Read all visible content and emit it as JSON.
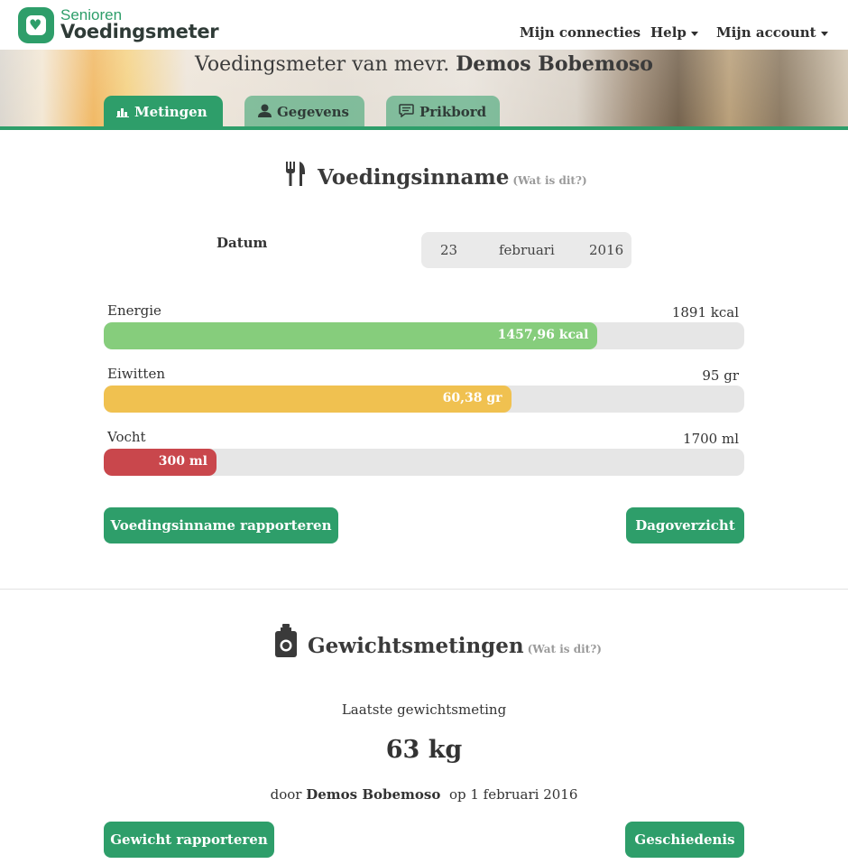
{
  "brand": {
    "top": "Senioren",
    "bottom": "Voedingsmeter"
  },
  "nav": {
    "connections": "Mijn connecties",
    "help": "Help",
    "account": "Mijn account"
  },
  "banner": {
    "prefix": "Voedingsmeter van mevr.",
    "name": "Demos Bobemoso"
  },
  "tabs": [
    {
      "label": "Metingen",
      "icon": "bar-chart-icon"
    },
    {
      "label": "Gegevens",
      "icon": "user-icon"
    },
    {
      "label": "Prikbord",
      "icon": "chat-icon"
    }
  ],
  "intake": {
    "title": "Voedingsinname",
    "help": "(Wat is dit?)",
    "date_label": "Datum",
    "date": {
      "day": "23",
      "month": "februari",
      "year": "2016"
    },
    "bars": [
      {
        "label": "Energie",
        "max": "1891 kcal",
        "value": "1457,96 kcal",
        "fraction": 0.771,
        "color": "#86cd7c"
      },
      {
        "label": "Eiwitten",
        "max": "95 gr",
        "value": "60,38 gr",
        "fraction": 0.636,
        "color": "#f0c150"
      },
      {
        "label": "Vocht",
        "max": "1700 ml",
        "value": "300 ml",
        "fraction": 0.176,
        "color": "#c9474c"
      }
    ],
    "report_button": "Voedingsinname rapporteren",
    "overview_button": "Dagoverzicht"
  },
  "weight": {
    "title": "Gewichtsmetingen",
    "help": "(Wat is dit?)",
    "last_label": "Laatste gewichtsmeting",
    "value": "63 kg",
    "by_prefix": "door",
    "by_name": "Demos Bobemoso",
    "by_date": "op 1 februari 2016",
    "report_button": "Gewicht rapporteren",
    "history_button": "Geschiedenis"
  },
  "colors": {
    "accent": "#2e9e6a"
  }
}
